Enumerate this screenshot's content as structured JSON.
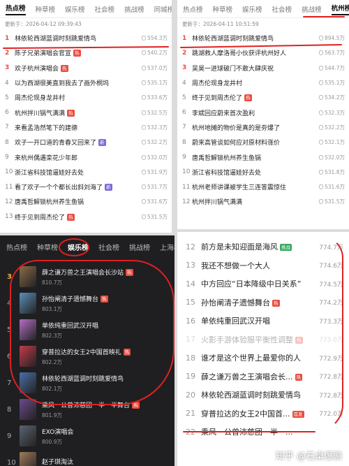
{
  "panelA": {
    "tabs": [
      "热点榜",
      "种草榜",
      "娱乐榜",
      "社会榜",
      "挑战榜",
      "同城榜"
    ],
    "updated": "更新于：2026-04-12 09:39:43",
    "items": [
      {
        "rank": "1",
        "title": "林依轮西湖蓝调时刻跳爱情鸟",
        "heat": "554.3万"
      },
      {
        "rank": "2",
        "title": "陈子兄弟演唱会官宣",
        "heat": "540.2万",
        "badge": "热"
      },
      {
        "rank": "3",
        "title": "欢子杭州演唱会",
        "heat": "537.0万",
        "badge": "热"
      },
      {
        "rank": "4",
        "title": "以为西湖很美直到我去了画外桐坞",
        "heat": "535.1万"
      },
      {
        "rank": "5",
        "title": "周杰伦现身龙井村",
        "heat": "533.6万"
      },
      {
        "rank": "6",
        "title": "杭州拌川锅气满满",
        "heat": "532.5万",
        "badge": "热"
      },
      {
        "rank": "7",
        "title": "来看孟浩然笔下的建德",
        "heat": "532.3万"
      },
      {
        "rank": "8",
        "title": "欢子一开口道的青春又回来了",
        "heat": "532.2万",
        "badge": "新"
      },
      {
        "rank": "9",
        "title": "来杭州偶遇栾花少年郎",
        "heat": "532.0万"
      },
      {
        "rank": "10",
        "title": "浙江省科技馆逼娃好去处",
        "heat": "531.9万"
      },
      {
        "rank": "11",
        "title": "看了欢子一个个都长出斜刘海了",
        "heat": "531.7万",
        "badge": "新"
      },
      {
        "rank": "12",
        "title": "唐禹哲解锁杭州养生鱼锅",
        "heat": "531.6万"
      },
      {
        "rank": "13",
        "title": "终于见到周杰伦了",
        "heat": "531.5万",
        "badge": "热"
      }
    ]
  },
  "panelB": {
    "tabs": [
      "热点榜",
      "种草榜",
      "娱乐榜",
      "社会榜",
      "挑战榜",
      "杭州榜"
    ],
    "updated": "更新于：2026-04-11 10:51:59",
    "items": [
      {
        "rank": "1",
        "title": "林依轮西湖蓝调时刻跳爱情鸟",
        "heat": "894.5万"
      },
      {
        "rank": "2",
        "title": "跳湖救人摩洛哥小伙获评杭州好人",
        "heat": "563.7万"
      },
      {
        "rank": "3",
        "title": "吴昊一进球破门不敢大肆庆祝",
        "heat": "544.7万"
      },
      {
        "rank": "4",
        "title": "周杰伦现身龙井村",
        "heat": "535.1万"
      },
      {
        "rank": "5",
        "title": "终于见到周杰伦了",
        "heat": "534.2万",
        "badge": "热"
      },
      {
        "rank": "6",
        "title": "李斌回应蔚来首次盈利",
        "heat": "532.3万"
      },
      {
        "rank": "7",
        "title": "杭州地摊的物价是真的是夯爆了",
        "heat": "532.2万"
      },
      {
        "rank": "8",
        "title": "蔚来高管谈如何应对原材料涨价",
        "heat": "532.1万"
      },
      {
        "rank": "9",
        "title": "唐禹哲解锁杭州养生鱼锅",
        "heat": "532.0万"
      },
      {
        "rank": "10",
        "title": "浙江省科技馆逼娃好去处",
        "heat": "531.8万"
      },
      {
        "rank": "11",
        "title": "杭州老师讲课被学生三连答震惊住",
        "heat": "531.6万"
      },
      {
        "rank": "12",
        "title": "杭州拌川锅气满满",
        "heat": "531.5万"
      }
    ]
  },
  "panelC": {
    "tabs": [
      "热点榜",
      "种草榜",
      "娱乐榜",
      "社会榜",
      "挑战榜",
      "上海榜"
    ],
    "items": [
      {
        "rank": "3",
        "title": "薛之谦万兽之王演唱会长沙站",
        "heat": "810.7万",
        "color": "#8a6b4a",
        "badge": "热"
      },
      {
        "rank": "4",
        "title": "孙怡阐清子遗憾舞台",
        "heat": "803.1万",
        "color": "#5a8fb8",
        "badge": "热"
      },
      {
        "rank": "5",
        "title": "单依纯重回武汉开唱",
        "heat": "802.3万",
        "color": "#b36fc4"
      },
      {
        "rank": "6",
        "title": "穿普拉达的女王2中国首映礼",
        "heat": "802.2万",
        "color": "#c43b4b",
        "badge": "热"
      },
      {
        "rank": "7",
        "title": "林依轮西湖蓝调时刻跳爱情鸟",
        "heat": "802.1万",
        "color": "#4a6fa8"
      },
      {
        "rank": "8",
        "title": "乘风一公曾沛慈团一半一半舞台",
        "heat": "801.9万",
        "color": "#6b4a8a",
        "badge": "热"
      },
      {
        "rank": "9",
        "title": "EXO演唱会",
        "heat": "800.9万",
        "color": "#5b6470"
      },
      {
        "rank": "10",
        "title": "赵子琪淘汰",
        "heat": "",
        "color": "#a07a5a"
      }
    ]
  },
  "panelD": {
    "items": [
      {
        "rank": "12",
        "title": "前方是未知迎面是海风",
        "heat": "774.7万",
        "badge": "挑战"
      },
      {
        "rank": "13",
        "title": "我还不想做一个大人",
        "heat": "774.6万"
      },
      {
        "rank": "14",
        "title": "中方回应“日本降级中日关系”",
        "heat": "774.5万"
      },
      {
        "rank": "15",
        "title": "孙怡阐清子遗憾舞台",
        "heat": "774.2万",
        "badge": "热"
      },
      {
        "rank": "16",
        "title": "单依纯重回武汉开唱",
        "heat": "773.3万"
      },
      {
        "rank": "17",
        "title": "火影手游体验服平衡性调整",
        "heat": "773.0万",
        "badge": "热",
        "dim": true
      },
      {
        "rank": "18",
        "title": "谁才是这个世界上最爱你的人",
        "heat": "772.9万"
      },
      {
        "rank": "19",
        "title": "薛之谦万兽之王演唱会长...",
        "heat": "772.8万",
        "badge": "热"
      },
      {
        "rank": "20",
        "title": "林依轮西湖蓝调时刻跳爱情鸟",
        "heat": "772.8万"
      },
      {
        "rank": "21",
        "title": "穿普拉达的女王2中国首...",
        "heat": "772.0万",
        "badge": "首发"
      },
      {
        "rank": "22",
        "title": "乘风一公曾沛慈团一半一...",
        "heat": ""
      }
    ],
    "watermark": "知乎 @石桌爆剧"
  }
}
